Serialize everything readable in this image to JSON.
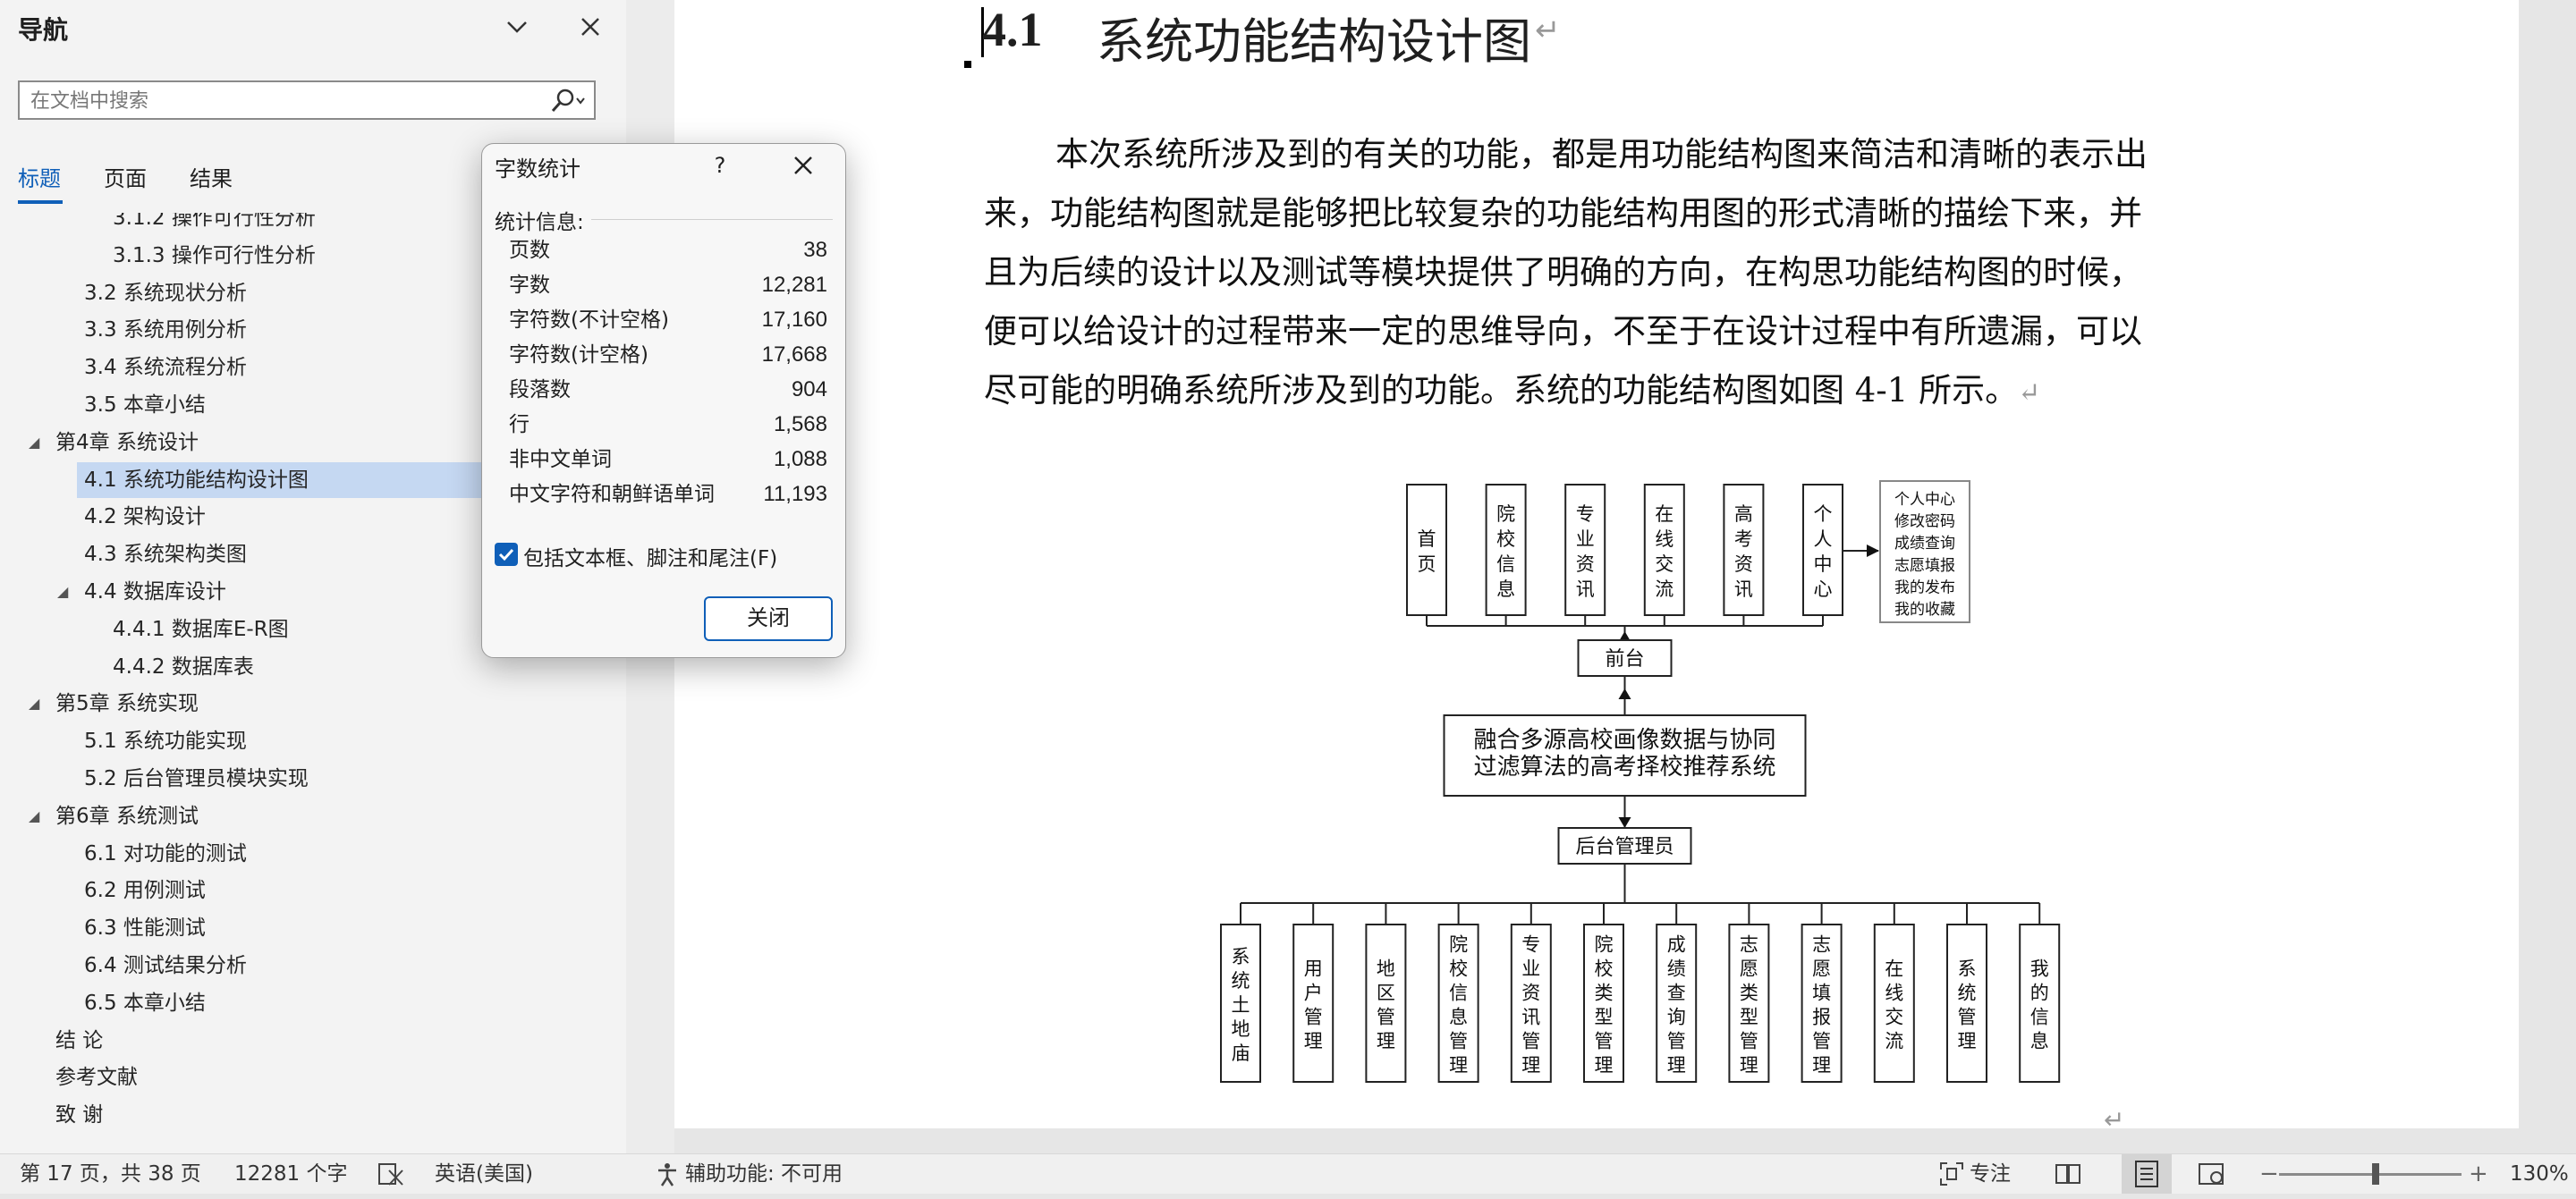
{
  "nav": {
    "title": "导航",
    "search_placeholder": "在文档中搜索",
    "tabs": [
      {
        "label": "标题",
        "active": true
      },
      {
        "label": "页面",
        "active": false
      },
      {
        "label": "结果",
        "active": false
      }
    ],
    "tree": [
      {
        "label": "3.1.2  操作可行性分析",
        "level": 3,
        "selected": false
      },
      {
        "label": "3.1.3  操作可行性分析",
        "level": 3,
        "selected": false
      },
      {
        "label": "3.2  系统现状分析",
        "level": 2,
        "selected": false
      },
      {
        "label": "3.3  系统用例分析",
        "level": 2,
        "selected": false
      },
      {
        "label": "3.4  系统流程分析",
        "level": 2,
        "selected": false
      },
      {
        "label": "3.5  本章小结",
        "level": 2,
        "selected": false
      },
      {
        "label": "第4章  系统设计",
        "level": 1,
        "caret": "◢",
        "selected": false
      },
      {
        "label": "4.1  系统功能结构设计图",
        "level": 2,
        "selected": true
      },
      {
        "label": "4.2  架构设计",
        "level": 2,
        "selected": false
      },
      {
        "label": "4.3  系统架构类图",
        "level": 2,
        "selected": false
      },
      {
        "label": "4.4  数据库设计",
        "level": 2,
        "caret": "◢",
        "selected": false
      },
      {
        "label": "4.4.1  数据库E-R图",
        "level": 3,
        "selected": false
      },
      {
        "label": "4.4.2  数据库表",
        "level": 3,
        "selected": false
      },
      {
        "label": "第5章  系统实现",
        "level": 1,
        "caret": "◢",
        "selected": false
      },
      {
        "label": "5.1  系统功能实现",
        "level": 2,
        "selected": false
      },
      {
        "label": "5.2  后台管理员模块实现",
        "level": 2,
        "selected": false
      },
      {
        "label": "第6章  系统测试",
        "level": 1,
        "caret": "◢",
        "selected": false
      },
      {
        "label": "6.1  对功能的测试",
        "level": 2,
        "selected": false
      },
      {
        "label": "6.2  用例测试",
        "level": 2,
        "selected": false
      },
      {
        "label": "6.3  性能测试",
        "level": 2,
        "selected": false
      },
      {
        "label": "6.4  测试结果分析",
        "level": 2,
        "selected": false
      },
      {
        "label": "6.5  本章小结",
        "level": 2,
        "selected": false
      },
      {
        "label": "结    论",
        "level": 1,
        "selected": false
      },
      {
        "label": "参考文献",
        "level": 1,
        "selected": false
      },
      {
        "label": "致    谢",
        "level": 1,
        "selected": false
      }
    ]
  },
  "doc": {
    "heading_number": "4.1",
    "heading_title": "系统功能结构设计图",
    "paragraph_mark": "↵",
    "body_lines": [
      "本次系统所涉及到的有关的功能，都是用功能结构图来简洁和清晰的表示出",
      "来，功能结构图就是能够把比较复杂的功能结构用图的形式清晰的描绘下来，并",
      "且为后续的设计以及测试等模块提供了明确的方向，在构思功能结构图的时候，",
      "便可以给设计的过程带来一定的思维导向，不至于在设计过程中有所遗漏，可以",
      "尽可能的明确系统所涉及到的功能。系统的功能结构图如图 4-1 所示。"
    ]
  },
  "diagram": {
    "top_nodes": [
      "首页",
      "院校信息",
      "专业资讯",
      "在线交流",
      "高考资讯",
      "个人中心"
    ],
    "personal_center_items": [
      "个人中心",
      "修改密码",
      "成绩查询",
      "志愿填报",
      "我的发布",
      "我的收藏"
    ],
    "frontend": "前台",
    "system_lines": [
      "融合多源高校画像数据与协同",
      "过滤算法的高考择校推荐系统"
    ],
    "admin": "后台管理员",
    "bottom_nodes": [
      "系统土地庙",
      "用户管理",
      "地区管理",
      "院校信息管理",
      "专业资讯管理",
      "院校类型管理",
      "成绩查询管理",
      "志愿类型管理",
      "志愿填报管理",
      "在线交流",
      "系统管理",
      "我的信息"
    ]
  },
  "dialog": {
    "title": "字数统计",
    "help": "?",
    "stats_label": "统计信息:",
    "stats": [
      {
        "label": "页数",
        "value": "38"
      },
      {
        "label": "字数",
        "value": "12,281"
      },
      {
        "label": "字符数(不计空格)",
        "value": "17,160"
      },
      {
        "label": "字符数(计空格)",
        "value": "17,668"
      },
      {
        "label": "段落数",
        "value": "904"
      },
      {
        "label": "行",
        "value": "1,568"
      },
      {
        "label": "非中文单词",
        "value": "1,088"
      },
      {
        "label": "中文字符和朝鲜语单词",
        "value": "11,193"
      }
    ],
    "checkbox_label": "包括文本框、脚注和尾注(F)",
    "checkbox_checked": true,
    "close_label": "关闭"
  },
  "status": {
    "page": "第 17 页，共 38 页",
    "words": "12281 个字",
    "language": "英语(美国)",
    "accessibility": "辅助功能: 不可用",
    "focus": "专注",
    "zoom": "130%",
    "zoom_minus": "−",
    "zoom_plus": "+"
  },
  "colors": {
    "accent": "#0f5fb8",
    "selected_item": "#c5d8f2"
  }
}
